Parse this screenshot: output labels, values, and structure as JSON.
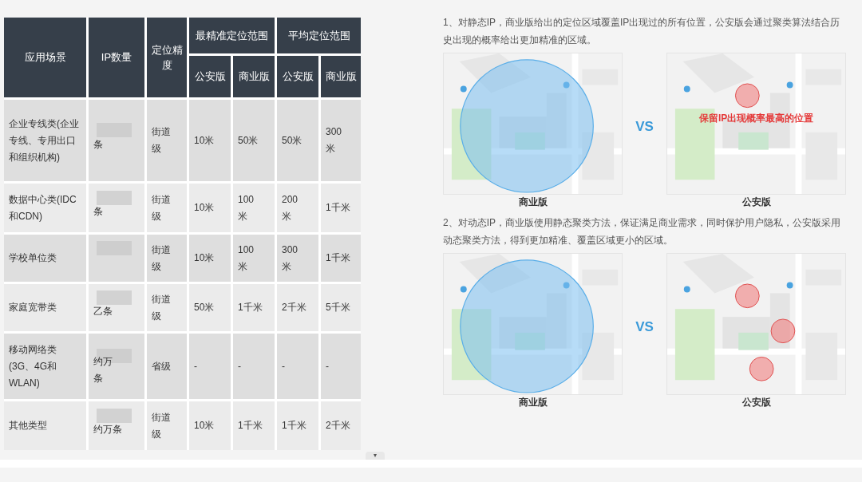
{
  "table": {
    "header_top": [
      "应用场景",
      "IP数量",
      "定位精度",
      "最精准定位范围",
      "平均定位范围"
    ],
    "header_sub": [
      "公安版",
      "商业版",
      "公安版",
      "商业版"
    ],
    "rows": [
      {
        "scenario": "企业专线类(企业专线、专用出口和组织机构)",
        "ip": "条",
        "redacted": true,
        "precision": "街道级",
        "values": [
          "10米",
          "50米",
          "50米",
          "300米"
        ]
      },
      {
        "scenario": "数据中心类(IDC和CDN)",
        "ip": "条",
        "redacted": true,
        "precision": "街道级",
        "values": [
          "10米",
          "100米",
          "200米",
          "1千米"
        ]
      },
      {
        "scenario": "学校单位类",
        "redacted": true,
        "precision": "街道级",
        "values": [
          "10米",
          "100米",
          "300米",
          "1千米"
        ]
      },
      {
        "scenario": "家庭宽带类",
        "ip": "乙条",
        "redacted": true,
        "precision": "街道级",
        "values": [
          "50米",
          "1千米",
          "2千米",
          "5千米"
        ]
      },
      {
        "scenario": "移动网络类(3G、4G和WLAN)",
        "ip": "约万条",
        "redacted": true,
        "precision": "省级",
        "values": [
          "-",
          "-",
          "-",
          "-"
        ]
      },
      {
        "scenario": "其他类型",
        "ip": "约万条",
        "redacted": true,
        "precision": "街道级",
        "values": [
          "10米",
          "1千米",
          "1千米",
          "2千米"
        ]
      }
    ]
  },
  "sections": [
    {
      "text": "1、对静态IP，商业版给出的定位区域覆盖IP出现过的所有位置，公安版会通过聚类算法结合历史出现的概率给出更加精准的区域。",
      "left_caption": "商业版",
      "vs": "VS",
      "right_caption": "公安版",
      "kind": "single",
      "annotation": "保留IP出现概率最高的位置"
    },
    {
      "text": "2、对动态IP，商业版使用静态聚类方法，保证满足商业需求，同时保护用户隐私，公安版采用动态聚类方法，得到更加精准、覆盖区域更小的区域。",
      "left_caption": "商业版",
      "vs": "VS",
      "right_caption": "公安版",
      "kind": "multi"
    }
  ],
  "collapse_handle": "▾"
}
